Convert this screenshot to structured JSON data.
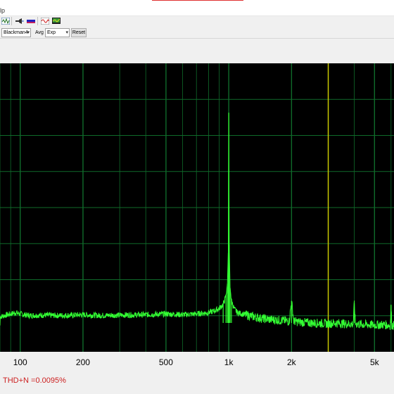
{
  "menu": {
    "help_fragment": "lp"
  },
  "toolbar": {
    "icons": [
      "waveform-icon",
      "speaker-icon",
      "spectrum-bar-icon",
      "sine-wave-icon",
      "monitor-icon"
    ],
    "window_select": "Blackman4",
    "avg_label": "Avg",
    "avg_select": "Exp",
    "reset_label": "Reset"
  },
  "colors": {
    "plot_background": "#000000",
    "grid": "#0f6b2a",
    "trace": "#33ff33",
    "marker": "#c8c800",
    "thd_text": "#cc1f1f"
  },
  "chart_data": {
    "type": "line",
    "xscale": "log",
    "xlabel": "",
    "ylabel": "",
    "xlim": [
      80,
      6200
    ],
    "x_ticks": [
      100,
      200,
      500,
      1000,
      2000,
      5000
    ],
    "x_tick_labels": [
      "100",
      "200",
      "500",
      "1k",
      "2k",
      "5k"
    ],
    "grid": true,
    "marker_freq": 3000,
    "series": [
      {
        "x": [
          80,
          95,
          100,
          110,
          130,
          150,
          180,
          200,
          240,
          300,
          400,
          500,
          600,
          700,
          800,
          850,
          900,
          940,
          970,
          985,
          995,
          1000,
          1005,
          1015,
          1030,
          1060,
          1100,
          1200,
          1400,
          1600,
          1800,
          1950,
          2000,
          2050,
          2200,
          2500,
          2800,
          3000,
          3200,
          3600,
          3950,
          4000,
          4050,
          4500,
          5000,
          5500,
          5950,
          6000,
          6050,
          6200
        ],
        "y": [
          8.5,
          9.5,
          9.2,
          8.8,
          8.9,
          8.8,
          8.9,
          9.0,
          8.8,
          8.9,
          9.0,
          9.2,
          9.0,
          9.2,
          9.5,
          9.9,
          10.5,
          11.5,
          13.5,
          16.5,
          24,
          58,
          26,
          15.5,
          12.5,
          10.5,
          9.5,
          9.0,
          8.2,
          7.8,
          7.6,
          7.4,
          12.3,
          7.4,
          7.2,
          7.0,
          6.9,
          6.8,
          7.0,
          6.8,
          6.7,
          11.8,
          6.8,
          6.6,
          6.5,
          6.6,
          6.4,
          11.4,
          6.5,
          6.4
        ]
      }
    ],
    "ylim": [
      0,
      70
    ]
  },
  "status": {
    "thd_text": "THD+N =0.0095%"
  }
}
